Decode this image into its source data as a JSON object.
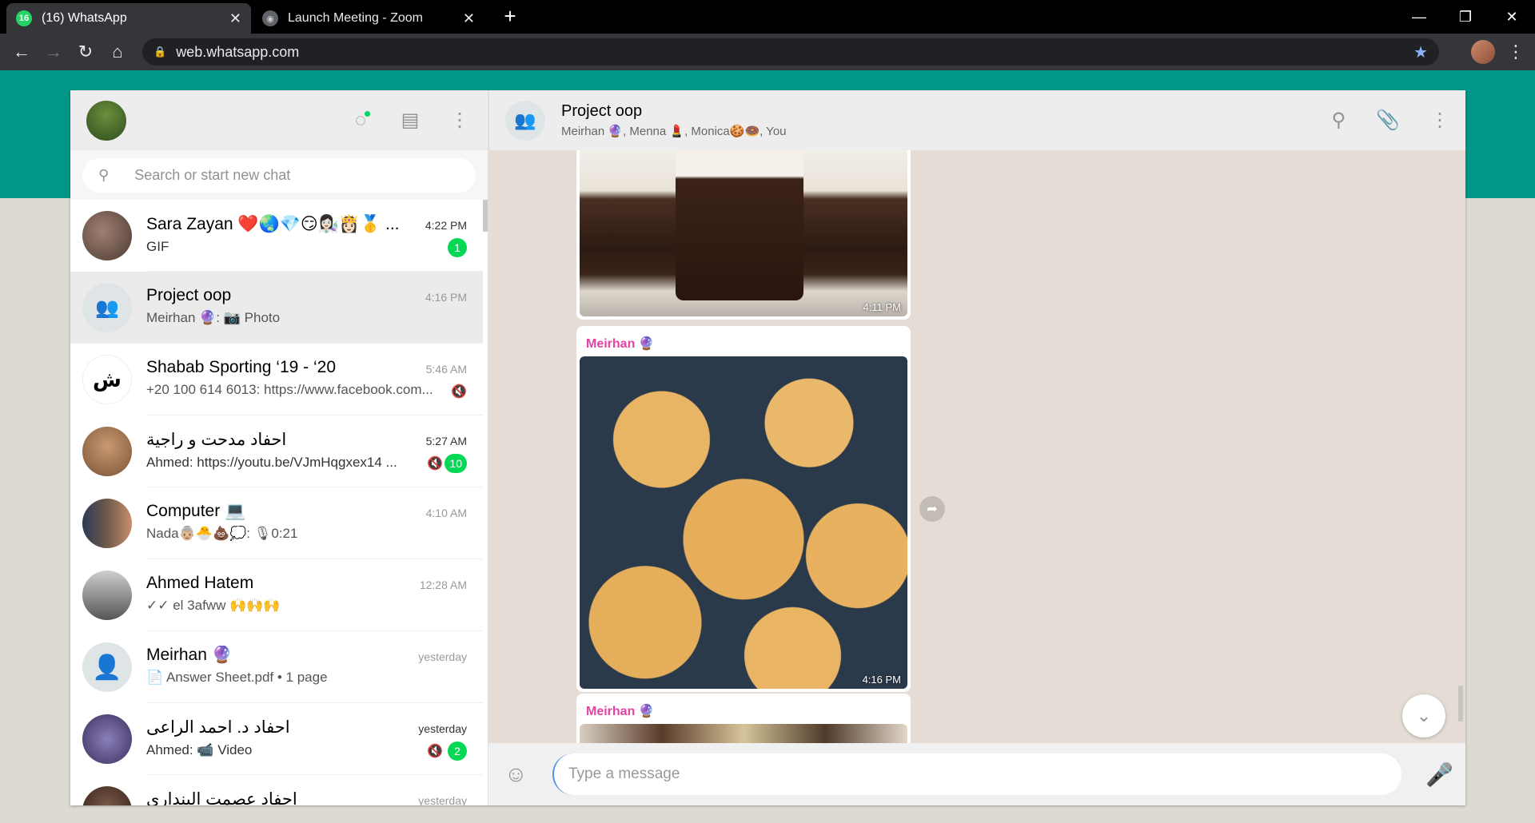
{
  "browser": {
    "tabs": [
      {
        "title": "(16) WhatsApp",
        "badge": "16",
        "close": "✕"
      },
      {
        "title": "Launch Meeting - Zoom",
        "close": "✕"
      }
    ],
    "new_tab": "+",
    "url": "web.whatsapp.com",
    "controls": {
      "minimize": "—",
      "maximize": "❐",
      "close": "✕"
    }
  },
  "sidebar": {
    "search_placeholder": "Search or start new chat",
    "chats": [
      {
        "name": "Sara Zayan ❤️🌏💎😏👩🏻‍🔬👸🏻🥇 ...",
        "time": "4:22 PM",
        "preview": "GIF",
        "unread": "1",
        "muted": false
      },
      {
        "name": "Project oop",
        "time": "4:16 PM",
        "preview": "Meirhan 🔮: 📷 Photo",
        "unread": "",
        "muted": false
      },
      {
        "name": "Shabab Sporting ‘19 - ‘20",
        "time": "5:46 AM",
        "preview": "+20 100 614 6013: https://www.facebook.com...",
        "unread": "",
        "muted": true
      },
      {
        "name": "احفاد مدحت و راجية",
        "time": "5:27 AM",
        "preview": "Ahmed: https://youtu.be/VJmHqgxex14 ...",
        "unread": "10",
        "muted": true
      },
      {
        "name": "Computer 💻",
        "time": "4:10 AM",
        "preview": "Nada👵🏼🐣💩💭: 🎙0:21",
        "unread": "",
        "muted": false
      },
      {
        "name": "Ahmed Hatem",
        "time": "12:28 AM",
        "preview": "✓✓ el 3afww 🙌🙌🙌",
        "unread": "",
        "muted": false
      },
      {
        "name": "Meirhan 🔮",
        "time": "yesterday",
        "preview": "📄 Answer Sheet.pdf • 1 page",
        "unread": "",
        "muted": false
      },
      {
        "name": "احفاد د. احمد الراعى",
        "time": "yesterday",
        "preview": "Ahmed: 📹 Video",
        "unread": "2",
        "muted": true
      },
      {
        "name": "احفاد عصمت البنداري",
        "time": "yesterday",
        "preview": "",
        "unread": "",
        "muted": false
      }
    ]
  },
  "conversation": {
    "title": "Project oop",
    "participants": "Meirhan 🔮, Menna 💄, Monica🍪🍩, You",
    "messages": [
      {
        "sender": "",
        "time": "4:11 PM"
      },
      {
        "sender": "Meirhan 🔮",
        "time": "4:16 PM"
      },
      {
        "sender": "Meirhan 🔮",
        "time": ""
      }
    ],
    "composer_placeholder": "Type a message"
  }
}
